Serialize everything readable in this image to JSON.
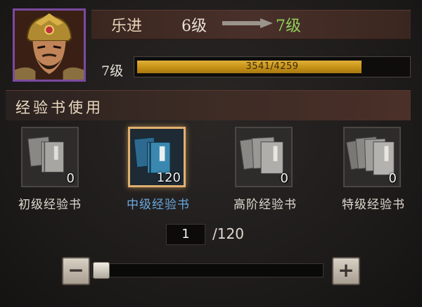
{
  "hero": {
    "name": "乐进",
    "level_from": "6级",
    "level_to": "7级"
  },
  "xp": {
    "level_label": "7级",
    "current": 3541,
    "max": 4259,
    "text": "3541/4259",
    "fill_fraction": 0.831
  },
  "section": {
    "title": "经验书使用"
  },
  "books": [
    {
      "label": "初级经验书",
      "count": "0",
      "selected": false,
      "icon": "gray-book-icon"
    },
    {
      "label": "中级经验书",
      "count": "120",
      "selected": true,
      "icon": "blue-book-icon"
    },
    {
      "label": "高阶经验书",
      "count": "0",
      "selected": false,
      "icon": "gray-book-icon"
    },
    {
      "label": "特级经验书",
      "count": "0",
      "selected": false,
      "icon": "gray-book-icon"
    }
  ],
  "quantity": {
    "value": "1",
    "max_text": "/120",
    "slider_fraction": 0.0
  },
  "buttons": {
    "minus": "−",
    "plus": "+"
  },
  "colors": {
    "accent_green": "#8fd05a",
    "selected_label": "#6aa8e0",
    "xp_gold": "#d8a428",
    "selected_border": "#e0b070"
  }
}
